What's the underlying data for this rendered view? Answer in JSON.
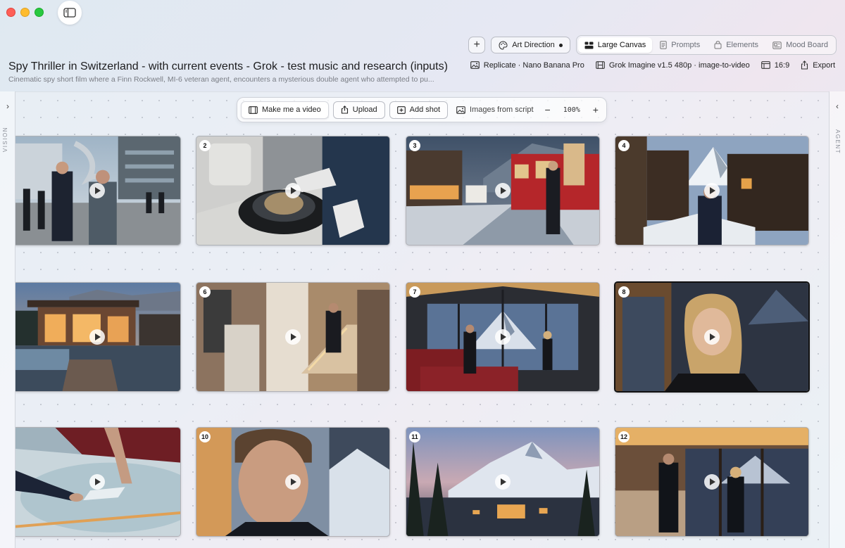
{
  "window": {
    "sidebar_toggle_icon": "sidebar-icon"
  },
  "toolbar": {
    "add_icon": "plus-icon",
    "add_label": "+",
    "art_direction_label": "Art Direction",
    "tabs": [
      {
        "label": "Large Canvas",
        "icon": "canvas-icon",
        "active": true
      },
      {
        "label": "Prompts",
        "icon": "document-icon",
        "active": false
      },
      {
        "label": "Elements",
        "icon": "elements-icon",
        "active": false
      },
      {
        "label": "Mood Board",
        "icon": "moodboard-icon",
        "active": false
      }
    ]
  },
  "project": {
    "title": "Spy Thriller in Switzerland - with current events - Grok - test music and research (inputs)",
    "subtitle": "Cinematic spy short film where a Finn Rockwell, MI-6 veteran agent, encounters a mysterious double agent who attempted to pu..."
  },
  "meta": {
    "image_model": "Replicate · Nano Banana Pro",
    "video_model": "Grok Imagine v1.5 480p · image-to-video",
    "aspect_ratio": "16:9",
    "export_label": "Export"
  },
  "rails": {
    "left_label": "VISION",
    "right_label": "AGENT",
    "left_chevron": "›",
    "right_chevron": "‹"
  },
  "action_bar": {
    "make_video_label": "Make me a video",
    "upload_label": "Upload",
    "add_shot_label": "Add shot",
    "images_from_script_label": "Images from script",
    "zoom_out": "−",
    "zoom_level": "100%",
    "zoom_in": "+"
  },
  "shots": [
    {
      "number": "",
      "scene": "Agents meeting outside modern building with steel sculpture"
    },
    {
      "number": "2",
      "scene": "Gloved hands opening case with device"
    },
    {
      "number": "3",
      "scene": "Snowy village street with red train at dusk"
    },
    {
      "number": "4",
      "scene": "Man in alpine village with Matterhorn"
    },
    {
      "number": "",
      "scene": "Modern chalet with pool at dusk"
    },
    {
      "number": "6",
      "scene": "Man climbing lit staircase"
    },
    {
      "number": "7",
      "scene": "Glass living room with mountain view"
    },
    {
      "number": "8",
      "scene": "Blonde woman portrait in chalet",
      "selected": true
    },
    {
      "number": "",
      "scene": "Hand placing object on glass table"
    },
    {
      "number": "10",
      "scene": "Close-up of man's face"
    },
    {
      "number": "11",
      "scene": "Matterhorn village at dusk"
    },
    {
      "number": "12",
      "scene": "Man and woman in chalet interior"
    }
  ]
}
